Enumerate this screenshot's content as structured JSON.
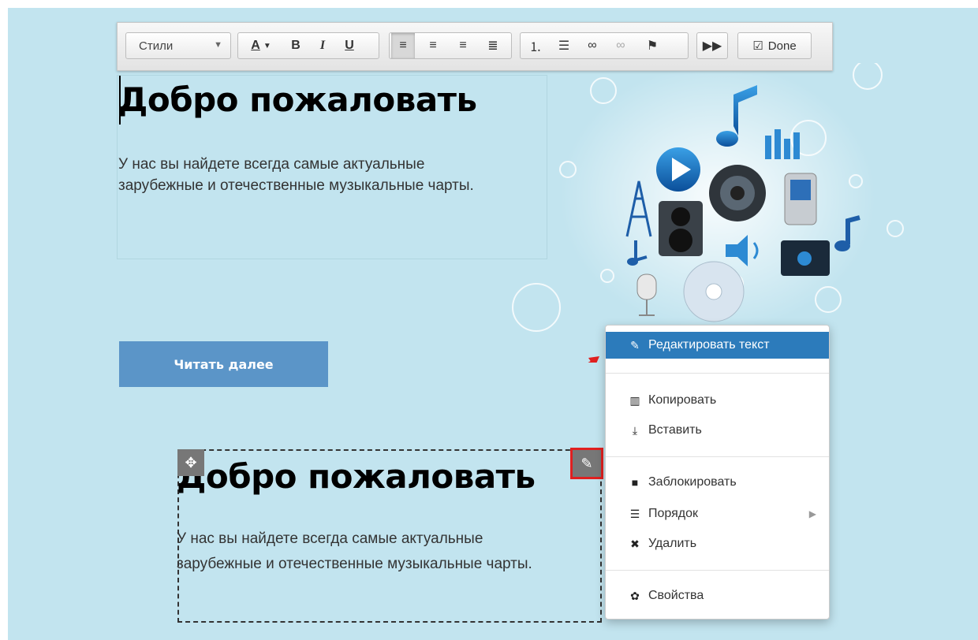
{
  "toolbar": {
    "styles_label": "Стили",
    "font_color_label": "A",
    "bold_label": "B",
    "italic_label": "I",
    "underline_label": "U",
    "done_label": "Done",
    "icons": [
      "align-left-icon",
      "align-center-icon",
      "align-right-icon",
      "align-justify-icon",
      "ordered-list-icon",
      "unordered-list-icon",
      "link-icon",
      "unlink-icon",
      "flag-icon",
      "forward-icon"
    ]
  },
  "block1": {
    "heading": "Добро пожаловать",
    "text": "У нас вы найдете всегда самые актуальные зарубежные и отечественные музыкальные чарты."
  },
  "read_more": {
    "label": "Читать далее"
  },
  "block2": {
    "heading": "Добро пожаловать",
    "text": "У нас вы найдете всегда самые актуальные зарубежные и отечественные музыкальные чарты."
  },
  "context_menu": {
    "edit_text": "Редактировать текст",
    "copy": "Копировать",
    "paste": "Вставить",
    "lock": "Заблокировать",
    "order": "Порядок",
    "delete": "Удалить",
    "properties": "Свойства"
  },
  "colors": {
    "canvas_bg": "#c2e4ef",
    "button_bg": "#5b95c8",
    "menu_highlight": "#2c7bbb",
    "annotation_red": "#e02020"
  }
}
